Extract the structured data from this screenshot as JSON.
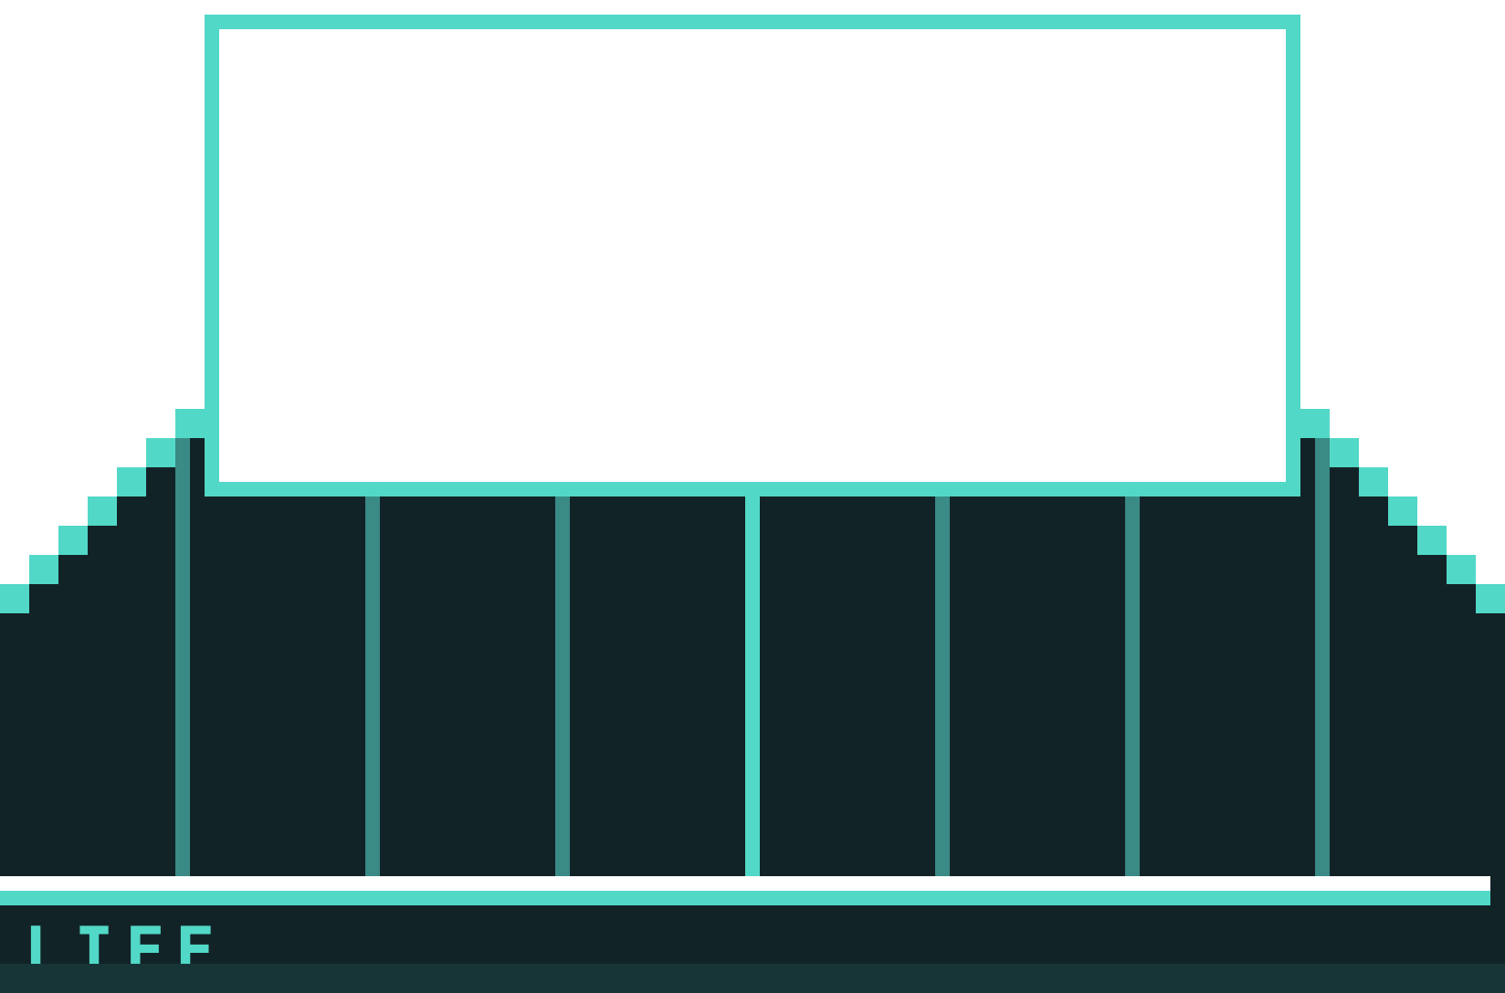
{
  "hud": {
    "life_label": "LIFE",
    "life_fraction": 1.0
  },
  "colors": {
    "wall": "#122327",
    "accent": "#52d8c7",
    "pillar": "#3a8a86",
    "window": "#ffffff",
    "bottom_strip": "#173536"
  },
  "icons": {
    "window": "empty-window-frame",
    "stairs": "pixel-staircase"
  }
}
